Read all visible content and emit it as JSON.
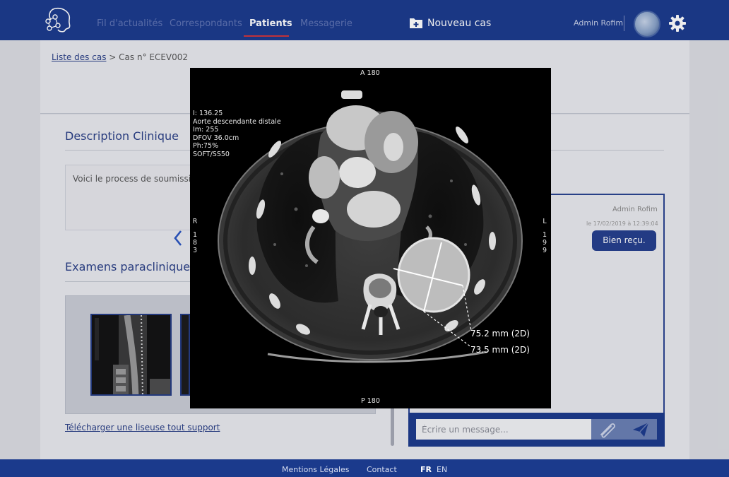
{
  "nav": {
    "items": [
      {
        "label": "Fil d'actualités",
        "active": false
      },
      {
        "label": "Correspondants",
        "active": false
      },
      {
        "label": "Patients",
        "active": true
      },
      {
        "label": "Messagerie",
        "active": false
      }
    ],
    "new_case_label": "Nouveau cas",
    "user_name": "Admin Rofim"
  },
  "breadcrumb": {
    "link": "Liste des cas",
    "separator": ">",
    "current": "Cas n° ECEV002"
  },
  "clinical": {
    "title": "Description Clinique",
    "text": "Voici le process de soumission"
  },
  "exams": {
    "title": "Examens paracliniques",
    "download_link": "Télécharger une liseuse tout support"
  },
  "chat": {
    "author": "Admin Rofim",
    "date": "le 17/02/2019 à 12:39:04",
    "message": "Bien reçu.",
    "input_placeholder": "Écrire un message..."
  },
  "viewer": {
    "orientation_top": "A 180",
    "orientation_bottom": "P 180",
    "orientation_left": [
      "R",
      "1",
      "8",
      "3"
    ],
    "orientation_right": [
      "L",
      "1",
      "9",
      "9"
    ],
    "info_lines": [
      "I: 136.25",
      "Aorte descendante distale",
      "Im: 255",
      "DFOV 36.0cm",
      "Ph:75%",
      "SOFT/SS50"
    ],
    "measurements": [
      "75.2 mm (2D)",
      "73.5 mm (2D)"
    ]
  },
  "footer": {
    "legal": "Mentions Légales",
    "contact": "Contact",
    "lang_fr": "FR",
    "lang_en": "EN"
  },
  "colors": {
    "brand": "#1b3a8c",
    "accent_underline": "#d0333b",
    "chat_bubble": "#243e8c"
  }
}
